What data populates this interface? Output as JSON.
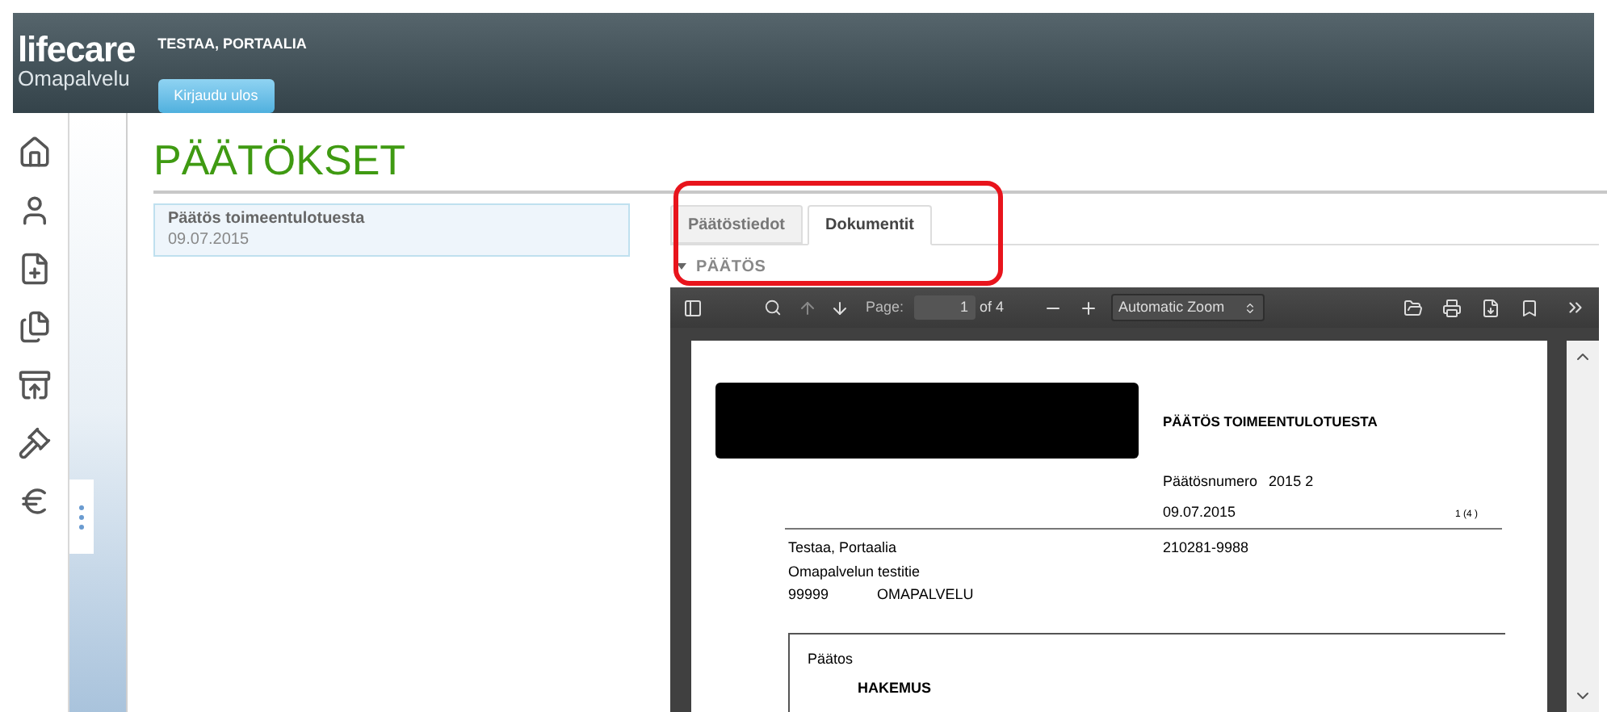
{
  "header": {
    "logo_name": "lifecare",
    "logo_subtitle": "Omapalvelu",
    "user_name": "TESTAA, PORTAALIA",
    "logout_button": "Kirjaudu ulos"
  },
  "nav": {
    "more_expanded": false
  },
  "page_title": "PÄÄTÖKSET",
  "decisions": [
    {
      "title": "Päätös toimeentulotuesta",
      "date": "09.07.2015",
      "selected": true
    }
  ],
  "tabs": [
    {
      "label": "Päätöstiedot",
      "selected": false
    },
    {
      "label": "Dokumentit",
      "selected": true
    }
  ],
  "section": {
    "title": "PÄÄTÖS",
    "expanded": true
  },
  "pdf_viewer": {
    "page_label": "Page:",
    "page_value": "1",
    "page_count": "of 4",
    "zoom": "Automatic Zoom"
  },
  "document": {
    "heading": "PÄÄTÖS TOIMEENTULOTUESTA",
    "number_label": "Päätösnumero",
    "number": "2015 2",
    "date": "09.07.2015",
    "page_number": "1 (4 )",
    "recipient": [
      "Testaa, Portaalia",
      "Omapalvelun testitie"
    ],
    "postal_code": "99999",
    "city": "OMAPALVELU",
    "person_id": "210281-9988",
    "box_title": "Päätos",
    "box_subtitle": "HAKEMUS"
  }
}
